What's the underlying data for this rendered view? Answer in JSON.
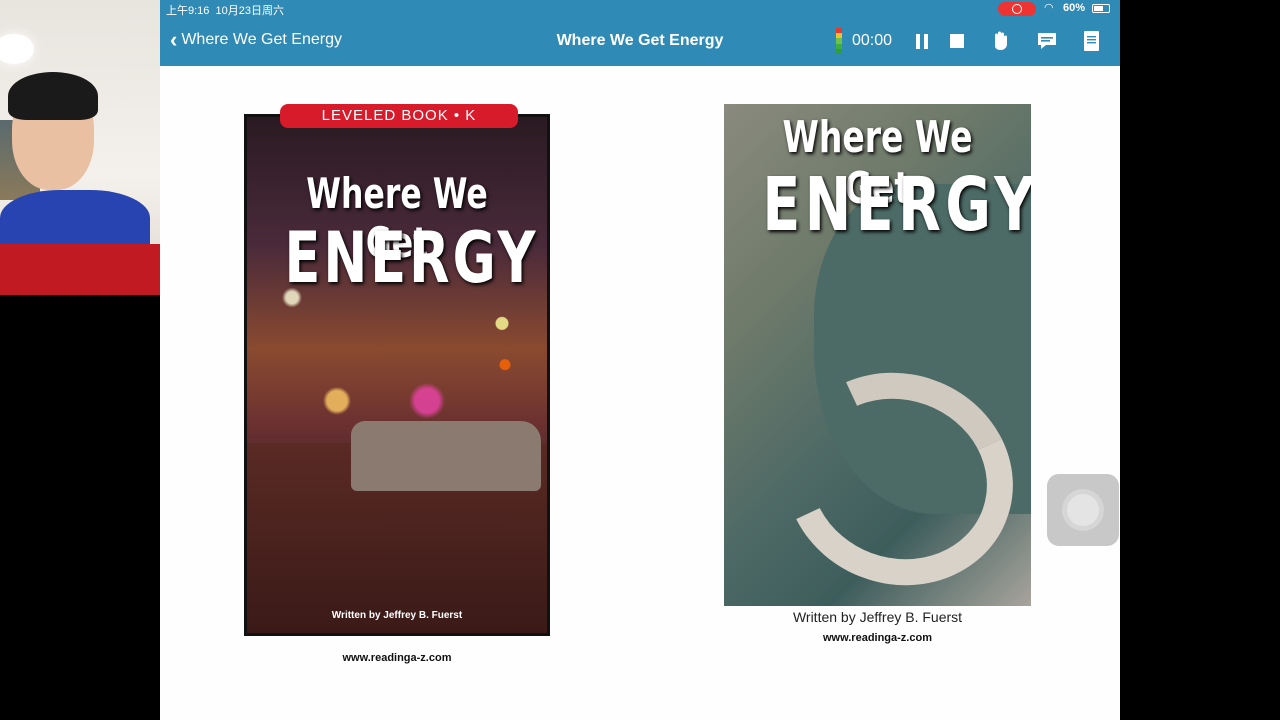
{
  "status_bar": {
    "time": "上午9:16",
    "date": "10月23日周六",
    "battery": "60%"
  },
  "nav": {
    "back_label": "Where We Get Energy",
    "title": "Where We Get Energy",
    "timer": "00:00",
    "meter_colors": [
      "#e33c2f",
      "#f2c12e",
      "#6cc24a",
      "#3fae3f",
      "#2e9e3e"
    ]
  },
  "left_cover": {
    "ribbon": "LEVELED BOOK • K",
    "title_line1": "Where We Get",
    "title_line2": "ENERGY",
    "author": "Written by Jeffrey B. Fuerst",
    "url": "www.readinga-z.com"
  },
  "right_cover": {
    "title_line1": "Where We Get",
    "title_line2": "ENERGY",
    "author": "Written by Jeffrey B. Fuerst",
    "url": "www.readinga-z.com"
  },
  "icons": {
    "back": "chevron-left-icon",
    "pause": "pause-icon",
    "stop": "stop-icon",
    "hand": "raise-hand-icon",
    "chat": "comment-icon",
    "notes": "notebook-icon",
    "assistive": "assistive-touch-icon"
  }
}
